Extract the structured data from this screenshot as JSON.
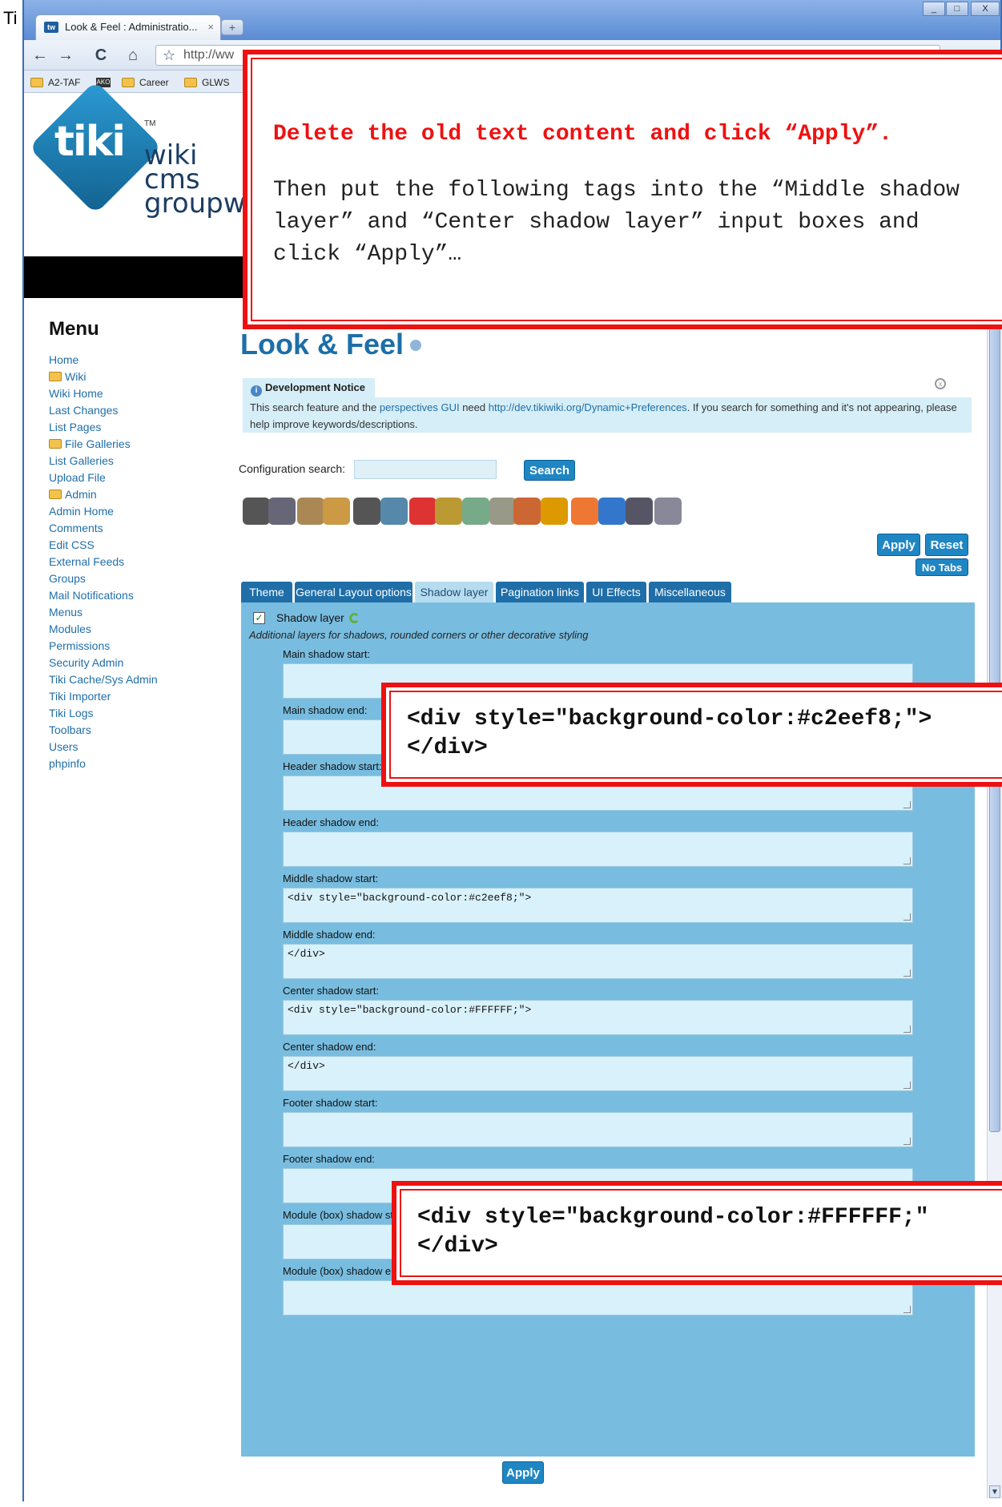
{
  "slide": {
    "title": "Ti"
  },
  "browser": {
    "tab_title": "Look & Feel : Administratio...",
    "tab_close": "×",
    "new_tab": "+",
    "window_controls": [
      "_",
      "□",
      "X"
    ],
    "nav": {
      "back": "←",
      "forward": "→",
      "reload": "C",
      "home": "⌂",
      "star": "☆"
    },
    "url": "http://ww",
    "bookmarks": [
      "A2-TAF",
      "AKO",
      "Career",
      "GLWS"
    ]
  },
  "logo": {
    "tiki": "tiki",
    "tm": "TM",
    "words": [
      "wiki",
      "cms",
      "groupwa"
    ]
  },
  "menu": {
    "title": "Menu",
    "items": [
      {
        "label": "Home",
        "folder": false
      },
      {
        "label": "Wiki",
        "folder": true
      },
      {
        "label": "Wiki Home",
        "folder": false
      },
      {
        "label": "Last Changes",
        "folder": false
      },
      {
        "label": "List Pages",
        "folder": false
      },
      {
        "label": "File Galleries",
        "folder": true
      },
      {
        "label": "List Galleries",
        "folder": false
      },
      {
        "label": "Upload File",
        "folder": false
      },
      {
        "label": "Admin",
        "folder": true
      },
      {
        "label": "Admin Home",
        "folder": false
      },
      {
        "label": "Comments",
        "folder": false
      },
      {
        "label": "Edit CSS",
        "folder": false
      },
      {
        "label": "External Feeds",
        "folder": false
      },
      {
        "label": "Groups",
        "folder": false
      },
      {
        "label": "Mail Notifications",
        "folder": false
      },
      {
        "label": "Menus",
        "folder": false
      },
      {
        "label": "Modules",
        "folder": false
      },
      {
        "label": "Permissions",
        "folder": false
      },
      {
        "label": "Security Admin",
        "folder": false
      },
      {
        "label": "Tiki Cache/Sys Admin",
        "folder": false
      },
      {
        "label": "Tiki Importer",
        "folder": false
      },
      {
        "label": "Tiki Logs",
        "folder": false
      },
      {
        "label": "Toolbars",
        "folder": false
      },
      {
        "label": "Users",
        "folder": false
      },
      {
        "label": "phpinfo",
        "folder": false
      }
    ]
  },
  "main": {
    "page_title": "Look & Feel",
    "notice": {
      "title": "Development Notice",
      "info_glyph": "i",
      "close_glyph": "x",
      "text_pre": "This search feature and the ",
      "link1": "perspectives GUI",
      "text_mid": " need ",
      "link2": "http://dev.tikiwiki.org/Dynamic+Preferences",
      "text_post": ". If you search for something and it's not appearing, please help improve keywords/descriptions."
    },
    "config_search": {
      "label": "Configuration search:",
      "value": "",
      "button": "Search"
    },
    "apply_label": "Apply",
    "reset_label": "Reset",
    "no_tabs_label": "No Tabs",
    "icon_names": [
      "tools-icon",
      "power-icon",
      "user-group-icon",
      "community-icon",
      "book-icon",
      "picture-icon",
      "flag-icon",
      "edit-icon",
      "plugins-icon",
      "mail-icon",
      "calendar-icon",
      "lock-icon",
      "rss-icon",
      "globe-icon",
      "text-icon",
      "layers-icon"
    ],
    "tabs": [
      "Theme",
      "General Layout options",
      "Shadow layer",
      "Pagination links",
      "UI Effects",
      "Miscellaneous"
    ],
    "active_tab": "Shadow layer",
    "shadow_panel": {
      "checkbox_label": "Shadow layer",
      "checked": true,
      "description": "Additional layers for shadows, rounded corners or other decorative styling",
      "fields": [
        {
          "label": "Main shadow start:",
          "value": ""
        },
        {
          "label": "Main shadow end:",
          "value": ""
        },
        {
          "label": "Header shadow start:",
          "value": ""
        },
        {
          "label": "Header shadow end:",
          "value": ""
        },
        {
          "label": "Middle shadow start:",
          "value": "<div style=\"background-color:#c2eef8;\">"
        },
        {
          "label": "Middle shadow end:",
          "value": "</div>"
        },
        {
          "label": "Center shadow start:",
          "value": "<div style=\"background-color:#FFFFFF;\">"
        },
        {
          "label": "Center shadow end:",
          "value": "</div>"
        },
        {
          "label": "Footer shadow start:",
          "value": ""
        },
        {
          "label": "Footer shadow end:",
          "value": ""
        },
        {
          "label": "Module (box) shadow start:",
          "value": ""
        },
        {
          "label": "Module (box) shadow end:",
          "value": ""
        }
      ]
    }
  },
  "callouts": {
    "instruction_red": "Delete the old text content and click “Apply”.",
    "instruction_black": "Then put the following tags into the “Middle shadow layer” and “Center shadow layer” input boxes and click “Apply”…",
    "code_middle": "<div style=\"background-color:#c2eef8;\">\n</div>",
    "code_center": "<div style=\"background-color:#FFFFFF;\"\n</div>"
  },
  "colors": {
    "callout_border": "#e11111",
    "panel_bg": "#78bde0",
    "field_bg": "#d9f1fb",
    "link": "#1f6ea8",
    "button": "#1f86c4"
  }
}
